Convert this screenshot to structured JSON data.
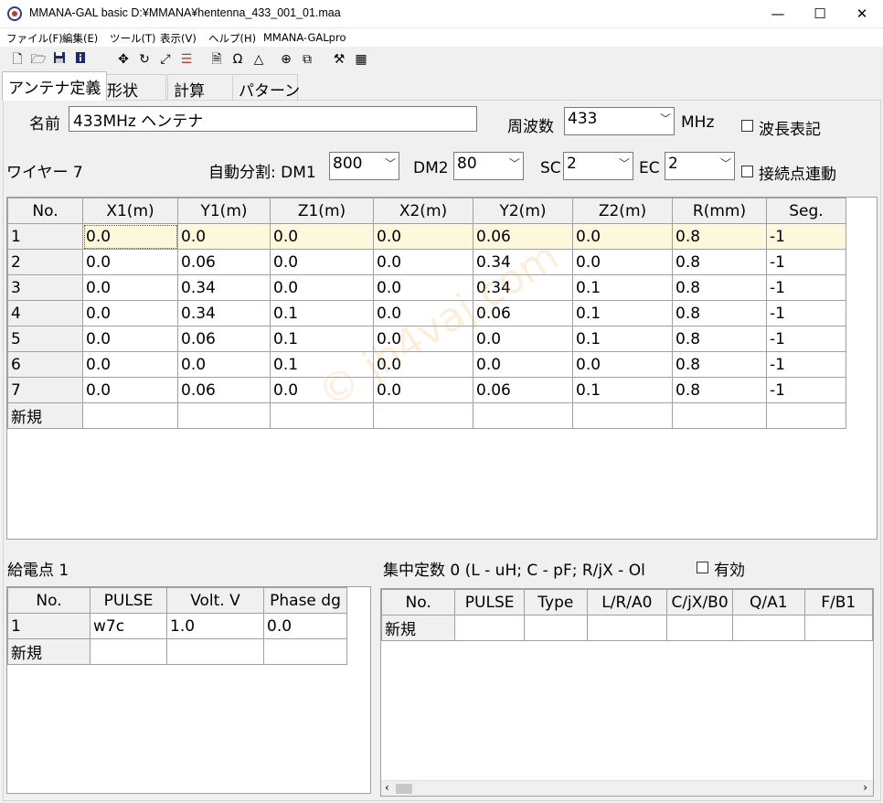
{
  "window": {
    "title": "MMANA-GAL basic  D:¥MMANA¥hentenna_433_001_01.maa",
    "minimize": "—",
    "maximize": "☐",
    "close": "✕"
  },
  "menu": [
    "ファイル(F)",
    "編集(E)",
    "ツール(T)",
    "表示(V)",
    "ヘルプ(H)",
    "MMANA-GALpro"
  ],
  "toolbar_icons": [
    "new-file-icon",
    "open-folder-icon",
    "save-icon",
    "info-icon",
    "move-icon",
    "rotate-icon",
    "resize-icon",
    "wire-edit-icon",
    "document-icon",
    "omega-icon",
    "triangle-icon",
    "target-icon",
    "copy-icon",
    "tools-icon",
    "calculator-icon"
  ],
  "tabs": [
    "アンテナ定義",
    "形状",
    "計算",
    "パターン"
  ],
  "antenna": {
    "name_label": "名前",
    "name_value": "433MHz ヘンテナ",
    "freq_label": "周波数",
    "freq_value": "433",
    "freq_unit": "MHz",
    "wavelength_label": "波長表記",
    "wavelength_checked": false
  },
  "wires": {
    "label": "ワイヤー 7",
    "autoseg_label": "自動分割: DM1",
    "dm1": "800",
    "dm2_label": "DM2",
    "dm2": "80",
    "sc_label": "SC",
    "sc": "2",
    "ec_label": "EC",
    "ec": "2",
    "connect_label": "接続点連動",
    "connect_checked": false,
    "columns": [
      "No.",
      "X1(m)",
      "Y1(m)",
      "Z1(m)",
      "X2(m)",
      "Y2(m)",
      "Z2(m)",
      "R(mm)",
      "Seg."
    ],
    "rows": [
      [
        "1",
        "0.0",
        "0.0",
        "0.0",
        "0.0",
        "0.06",
        "0.0",
        "0.8",
        "-1"
      ],
      [
        "2",
        "0.0",
        "0.06",
        "0.0",
        "0.0",
        "0.34",
        "0.0",
        "0.8",
        "-1"
      ],
      [
        "3",
        "0.0",
        "0.34",
        "0.0",
        "0.0",
        "0.34",
        "0.1",
        "0.8",
        "-1"
      ],
      [
        "4",
        "0.0",
        "0.34",
        "0.1",
        "0.0",
        "0.06",
        "0.1",
        "0.8",
        "-1"
      ],
      [
        "5",
        "0.0",
        "0.06",
        "0.1",
        "0.0",
        "0.0",
        "0.1",
        "0.8",
        "-1"
      ],
      [
        "6",
        "0.0",
        "0.0",
        "0.1",
        "0.0",
        "0.0",
        "0.0",
        "0.8",
        "-1"
      ],
      [
        "7",
        "0.0",
        "0.06",
        "0.0",
        "0.0",
        "0.06",
        "0.1",
        "0.8",
        "-1"
      ]
    ],
    "new_row": "新規"
  },
  "watermark": "© jh4vaj.com",
  "feed": {
    "label": "給電点 1",
    "columns": [
      "No.",
      "PULSE",
      "Volt. V",
      "Phase dg"
    ],
    "rows": [
      [
        "1",
        "w7c",
        "1.0",
        "0.0"
      ]
    ],
    "new_row": "新規"
  },
  "loads": {
    "label": "集中定数 0 (L - uH; C - pF; R/jX - Ol",
    "enable_label": "有効",
    "enable_checked": false,
    "columns": [
      "No.",
      "PULSE",
      "Type",
      "L/R/A0",
      "C/jX/B0",
      "Q/A1",
      "F/B1"
    ],
    "new_row": "新規"
  }
}
